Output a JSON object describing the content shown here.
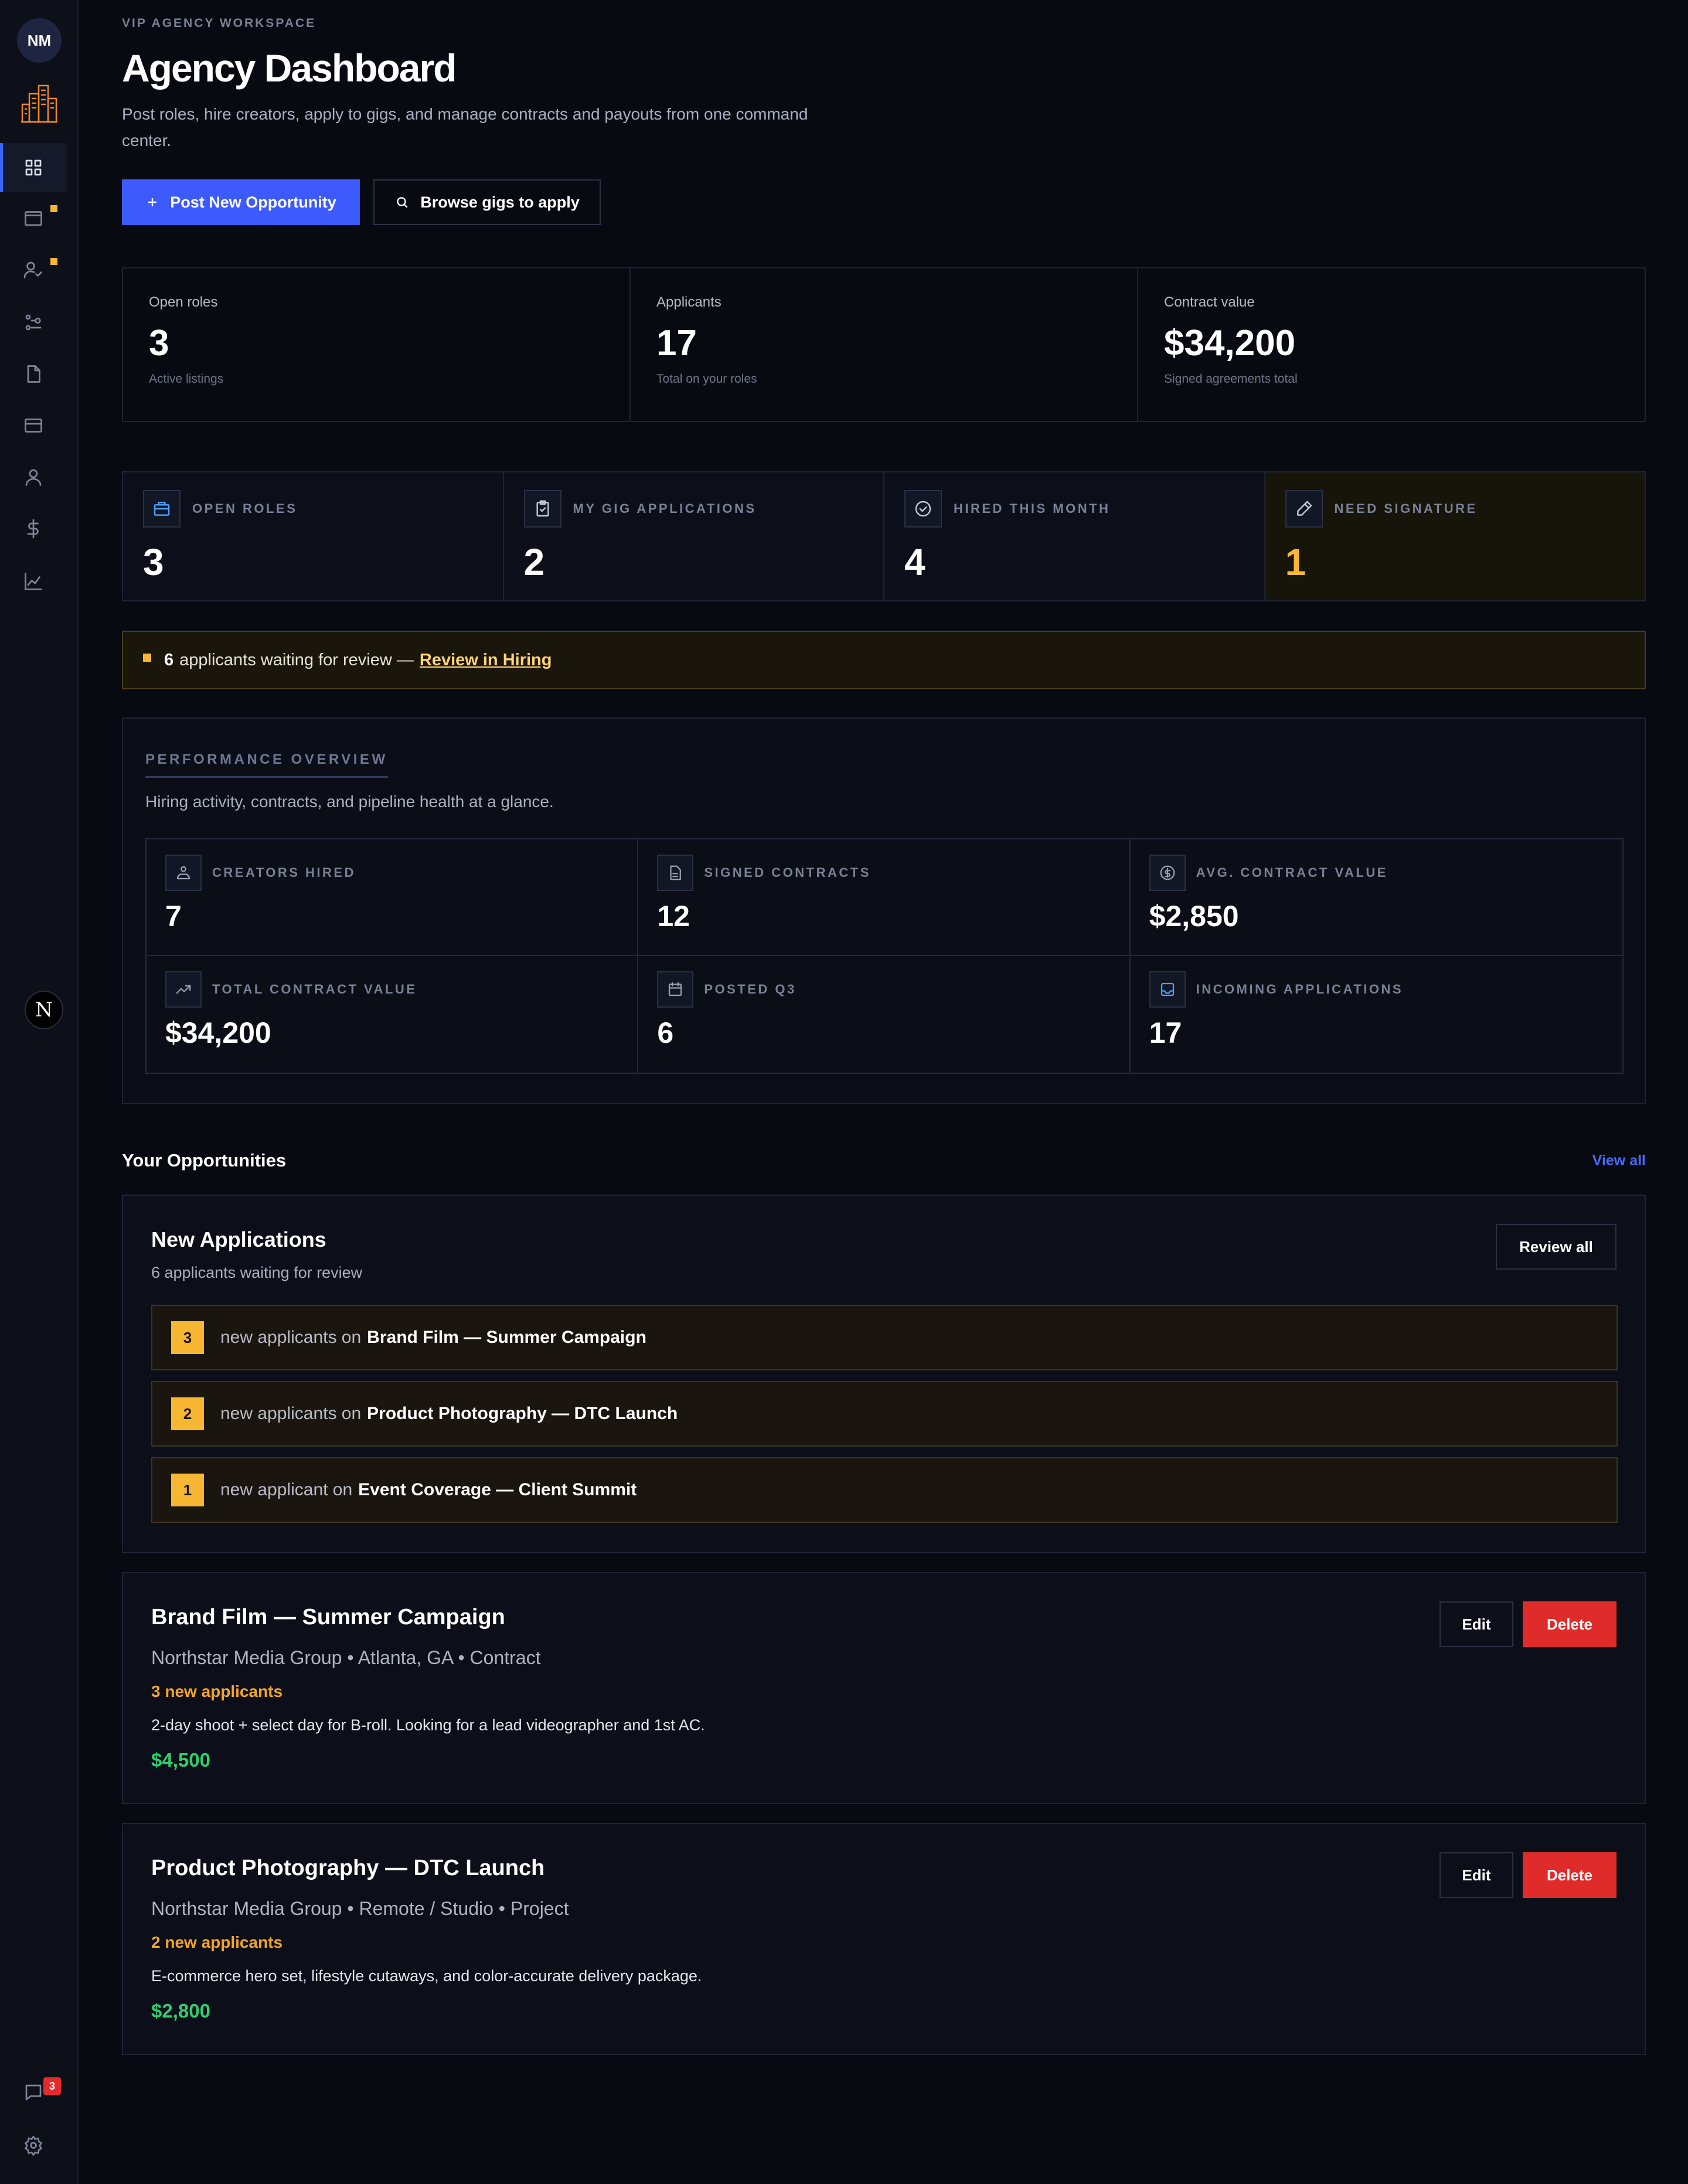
{
  "sidebar": {
    "avatar_initials": "NM",
    "badge_letter": "N",
    "messages_count": "3"
  },
  "header": {
    "eyebrow": "VIP AGENCY WORKSPACE",
    "title": "Agency Dashboard",
    "subtitle": "Post roles, hire creators, apply to gigs, and manage contracts and payouts from one command center.",
    "primary_button": "Post New Opportunity",
    "secondary_button": "Browse gigs to apply"
  },
  "summary": [
    {
      "label": "Open roles",
      "value": "3",
      "sub": "Active listings"
    },
    {
      "label": "Applicants",
      "value": "17",
      "sub": "Total on your roles"
    },
    {
      "label": "Contract value",
      "value": "$34,200",
      "sub": "Signed agreements total"
    }
  ],
  "kpis": [
    {
      "label": "OPEN ROLES",
      "value": "3",
      "icon": "briefcase-icon"
    },
    {
      "label": "MY GIG APPLICATIONS",
      "value": "2",
      "icon": "clipboard-check-icon"
    },
    {
      "label": "HIRED THIS MONTH",
      "value": "4",
      "icon": "check-circle-icon"
    },
    {
      "label": "NEED SIGNATURE",
      "value": "1",
      "icon": "pen-icon"
    }
  ],
  "alert": {
    "count": "6",
    "text": "applicants waiting for review —",
    "link": "Review in Hiring"
  },
  "performance": {
    "title": "PERFORMANCE OVERVIEW",
    "description": "Hiring activity, contracts, and pipeline health at a glance.",
    "metrics": [
      {
        "label": "CREATORS HIRED",
        "value": "7",
        "icon": "user-hired-icon"
      },
      {
        "label": "SIGNED CONTRACTS",
        "value": "12",
        "icon": "document-icon"
      },
      {
        "label": "AVG. CONTRACT VALUE",
        "value": "$2,850",
        "icon": "dollar-circle-icon"
      },
      {
        "label": "TOTAL CONTRACT VALUE",
        "value": "$34,200",
        "icon": "trending-up-icon"
      },
      {
        "label": "POSTED Q3",
        "value": "6",
        "icon": "calendar-icon"
      },
      {
        "label": "INCOMING APPLICATIONS",
        "value": "17",
        "icon": "inbox-icon"
      }
    ]
  },
  "opportunities": {
    "title": "Your Opportunities",
    "view_all": "View all",
    "new_applications": {
      "title": "New Applications",
      "subtitle": "6 applicants waiting for review",
      "review_all": "Review all",
      "rows": [
        {
          "count": "3",
          "text": "new applicants on",
          "job": "Brand Film — Summer Campaign"
        },
        {
          "count": "2",
          "text": "new applicants on",
          "job": "Product Photography — DTC Launch"
        },
        {
          "count": "1",
          "text": "new applicant on",
          "job": "Event Coverage — Client Summit"
        }
      ]
    },
    "jobs": [
      {
        "title": "Brand Film — Summer Campaign",
        "meta": "Northstar Media Group • Atlanta, GA • Contract",
        "new_applicants": "3 new applicants",
        "description": "2-day shoot + select day for B-roll. Looking for a lead videographer and 1st AC.",
        "price": "$4,500",
        "edit": "Edit",
        "delete": "Delete"
      },
      {
        "title": "Product Photography — DTC Launch",
        "meta": "Northstar Media Group • Remote / Studio • Project",
        "new_applicants": "2 new applicants",
        "description": "E-commerce hero set, lifestyle cutaways, and color-accurate delivery package.",
        "price": "$2,800",
        "edit": "Edit",
        "delete": "Delete"
      }
    ]
  },
  "colors": {
    "accent": "#3d5afe",
    "warning": "#f7b733",
    "danger": "#e02b2b",
    "success": "#2fcf6f"
  }
}
